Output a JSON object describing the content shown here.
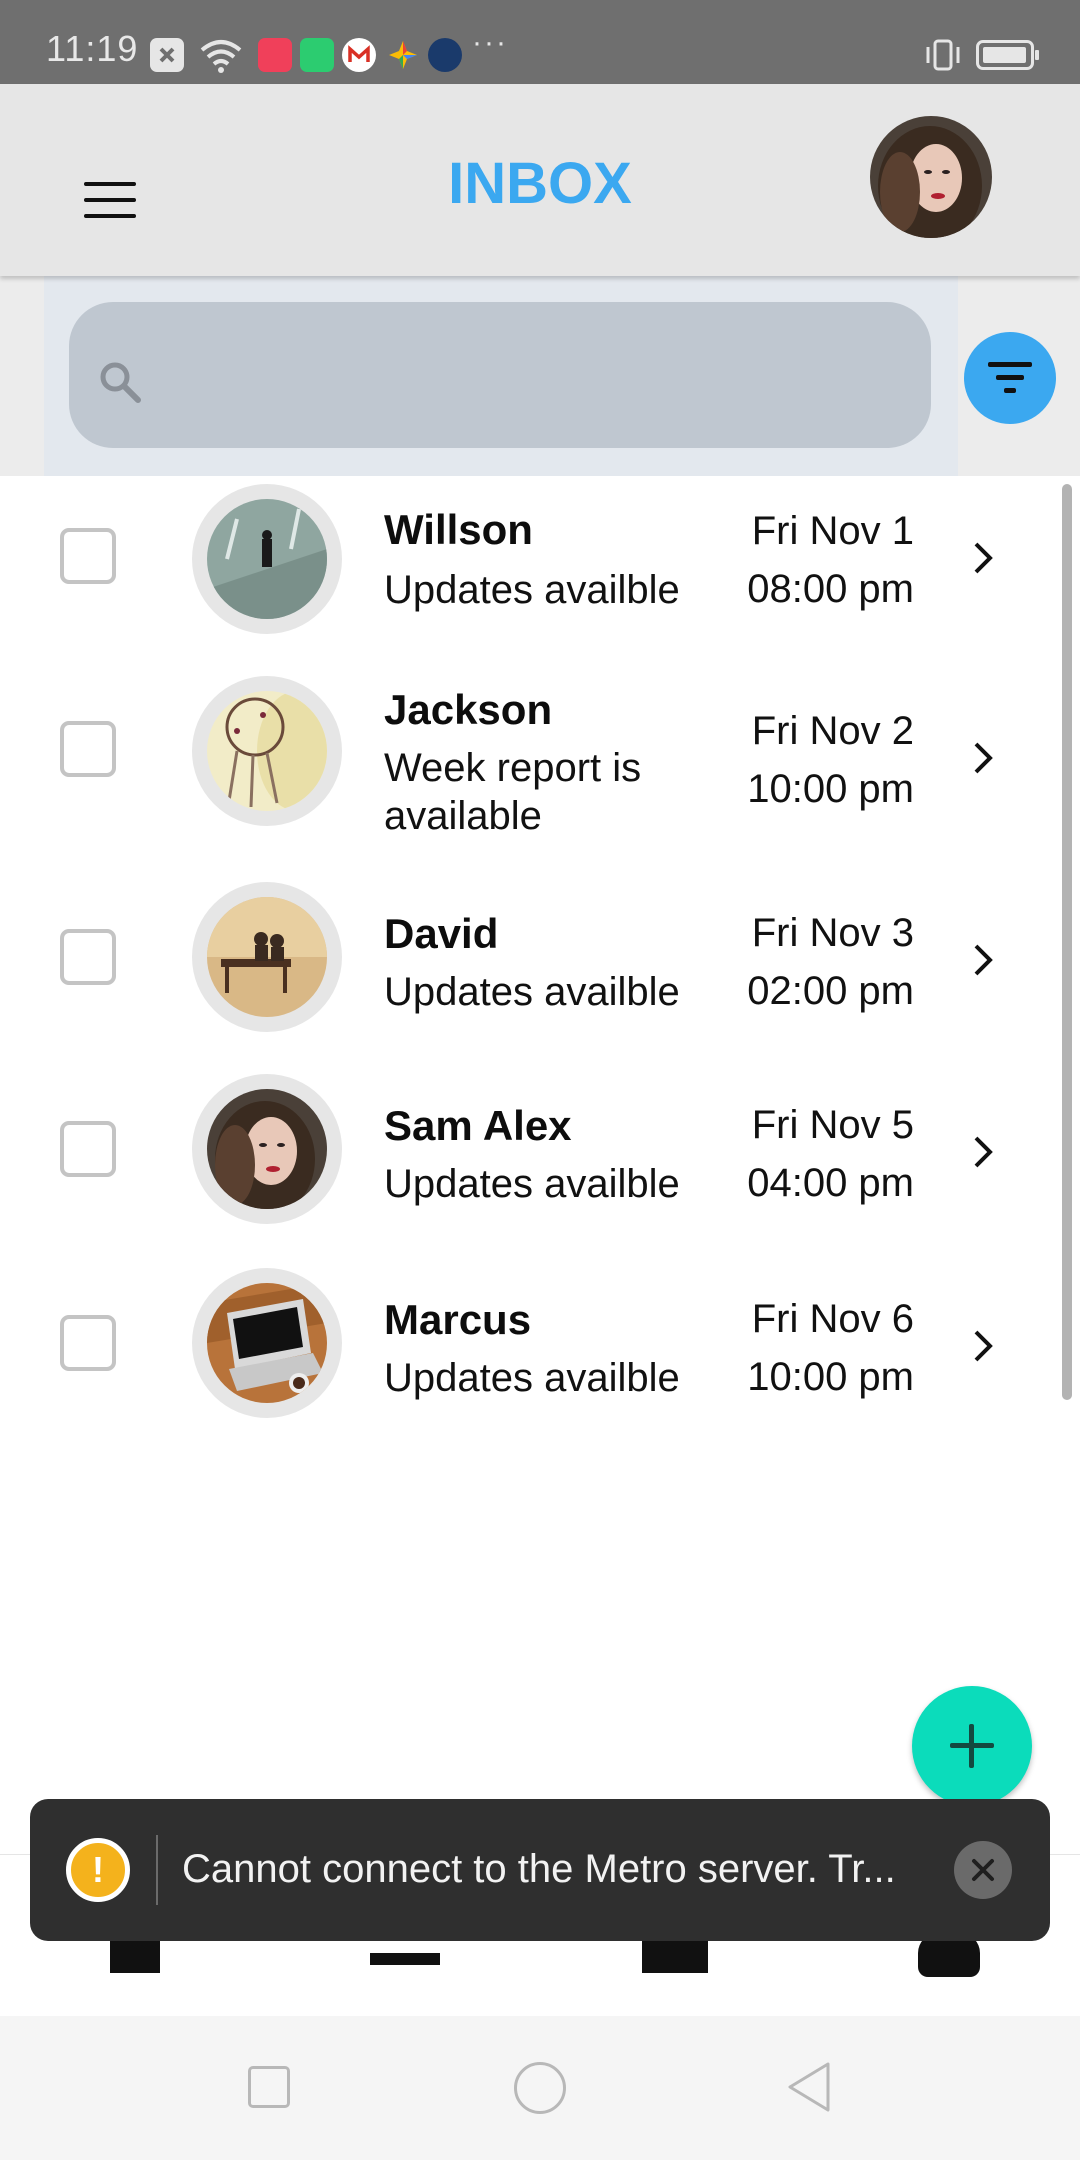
{
  "status_bar": {
    "time": "11:19",
    "icons": [
      "close-box-icon",
      "wifi-icon",
      "pinterest-icon",
      "chat-icon",
      "gmail-icon",
      "photos-icon",
      "amazon-icon"
    ],
    "overflow": "···",
    "battery": "battery-icon"
  },
  "header": {
    "title": "INBOX",
    "menu_icon": "hamburger-icon",
    "avatar": "profile-avatar"
  },
  "search": {
    "placeholder": "",
    "value": ""
  },
  "colors": {
    "accent": "#3ba8f0",
    "fab": "#0bdcbb",
    "toast_bg": "#2f2f2f",
    "warning": "#f4b21c"
  },
  "messages": [
    {
      "name": "Willson",
      "text": "Updates availble",
      "date": "Fri Nov 1",
      "time": "08:00 pm"
    },
    {
      "name": "Jackson",
      "text": "Week report is available",
      "date": "Fri Nov 2",
      "time": "10:00 pm"
    },
    {
      "name": "David",
      "text": "Updates availble",
      "date": "Fri Nov 3",
      "time": "02:00 pm"
    },
    {
      "name": "Sam Alex",
      "text": "Updates availble",
      "date": "Fri Nov 5",
      "time": "04:00 pm"
    },
    {
      "name": "Marcus",
      "text": "Updates availble",
      "date": "Fri Nov 6",
      "time": "10:00 pm"
    }
  ],
  "toast": {
    "message": "Cannot connect to the Metro server.  Tr...",
    "icon": "warning-icon",
    "close_icon": "close-icon"
  },
  "tab_bar": {
    "icons": [
      "home-icon",
      "inbox-icon",
      "tasks-icon",
      "user-icon"
    ]
  },
  "nav_bar": {
    "icons": [
      "recents-icon",
      "home-circle-icon",
      "back-icon"
    ]
  }
}
